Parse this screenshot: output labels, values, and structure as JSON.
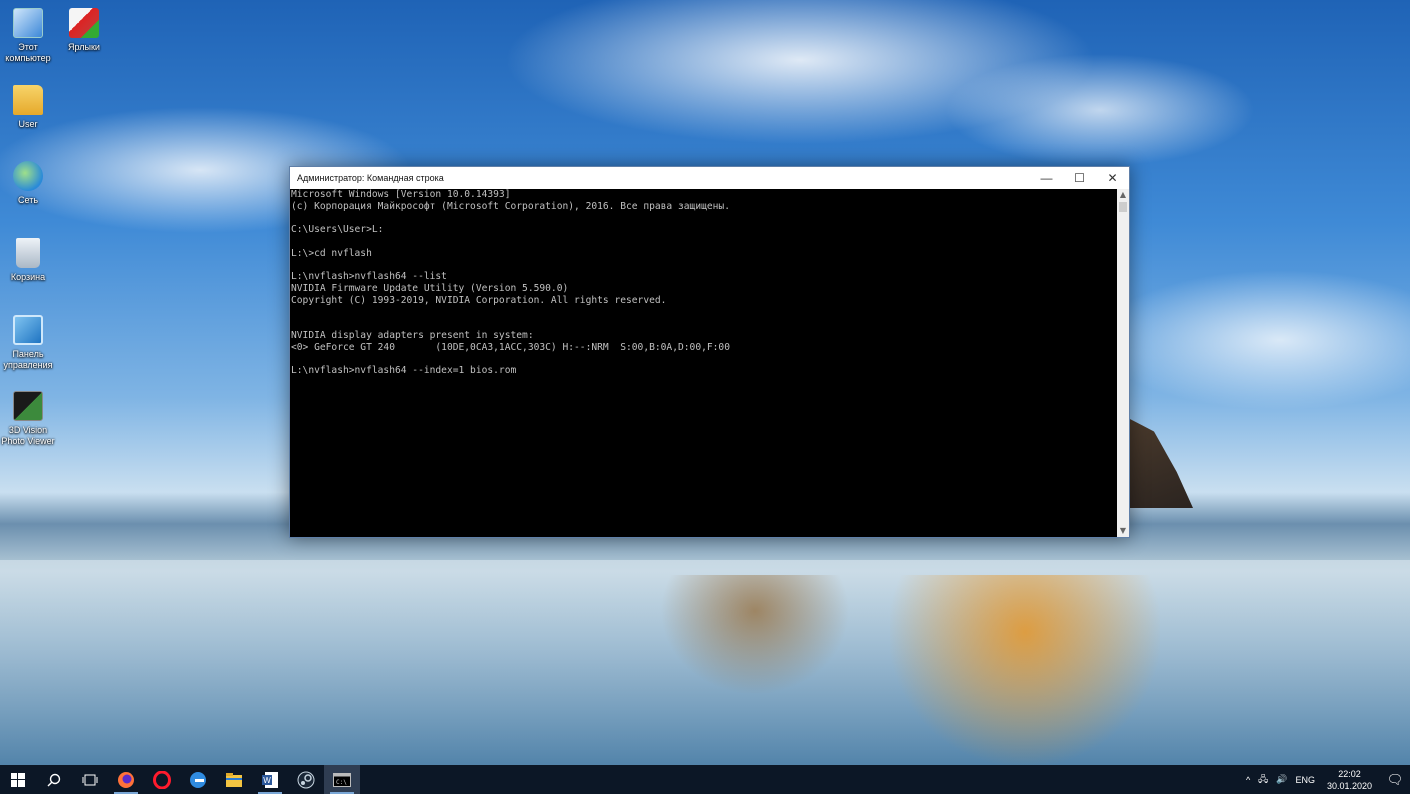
{
  "desktop": {
    "icons": [
      {
        "label": "Этот компьютер",
        "icon": "computer-icon"
      },
      {
        "label": "Ярлыки",
        "icon": "shortcuts-folder-icon"
      },
      {
        "label": "User",
        "icon": "user-folder-icon"
      },
      {
        "label": "Сеть",
        "icon": "network-icon"
      },
      {
        "label": "Корзина",
        "icon": "recycle-bin-icon"
      },
      {
        "label": "Панель управления",
        "icon": "control-panel-icon"
      },
      {
        "label": "3D Vision Photo Viewer",
        "icon": "3d-vision-icon"
      }
    ]
  },
  "window": {
    "title": "Администратор: Командная строка",
    "minimize": "—",
    "maximize": "☐",
    "close": "✕",
    "lines": [
      "Microsoft Windows [Version 10.0.14393]",
      "(c) Корпорация Майкрософт (Microsoft Corporation), 2016. Все права защищены.",
      "",
      "C:\\Users\\User>L:",
      "",
      "L:\\>cd nvflash",
      "",
      "L:\\nvflash>nvflash64 --list",
      "NVIDIA Firmware Update Utility (Version 5.590.0)",
      "Copyright (C) 1993-2019, NVIDIA Corporation. All rights reserved.",
      "",
      "",
      "NVIDIA display adapters present in system:",
      "<0> GeForce GT 240       (10DE,0CA3,1ACC,303C) H:--:NRM  S:00,B:0A,D:00,F:00",
      "",
      "L:\\nvflash>nvflash64 --index=1 bios.rom"
    ]
  },
  "taskbar": {
    "apps": [
      "start-icon",
      "search-icon",
      "task-view-icon",
      "firefox-icon",
      "opera-icon",
      "edge-icon",
      "file-explorer-icon",
      "word-icon",
      "steam-icon",
      "cmd-icon"
    ],
    "tray": {
      "chevron": "^",
      "network": "🖧",
      "volume": "🔊",
      "language": "ENG",
      "time": "22:02",
      "date": "30.01.2020",
      "notifications": "🗨"
    }
  },
  "colors": {
    "console_text": "#c0c0c0",
    "console_bg": "#000000",
    "taskbar_bg": "#0c1726"
  }
}
